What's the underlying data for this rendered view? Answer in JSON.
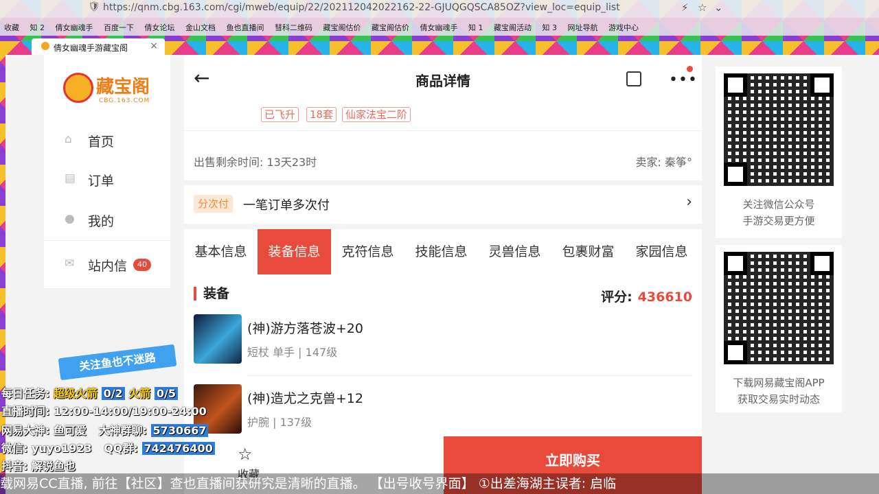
{
  "browser": {
    "url": "https://qnm.cbg.163.com/cgi/mweb/equip/22/202112042022162-22-GJUQGQSCA85OZ?view_loc=equip_list",
    "bookmarks": [
      "收藏",
      "知 2",
      "倩女幽魂手",
      "百度一下",
      "倩女论坛",
      "金山文档",
      "鱼也直播间",
      "彗科二维码",
      "藏宝阁估价",
      "藏宝阁估价",
      "倩女幽魂手",
      "知 1",
      "藏宝阁活动",
      "知 3",
      "网址导航",
      "游戏中心"
    ],
    "tab_title": "倩女幽魂手游藏宝阁"
  },
  "sidebar": {
    "logo_name": "藏宝阁",
    "logo_sub": "CBG.163.COM",
    "items": [
      {
        "label": "首页",
        "icon": "home-icon"
      },
      {
        "label": "订单",
        "icon": "order-icon"
      },
      {
        "label": "我的",
        "icon": "user-icon"
      }
    ],
    "messages": {
      "label": "站内信",
      "count": "40"
    }
  },
  "header": {
    "title": "商品详情"
  },
  "tags": [
    "已飞升",
    "18套",
    "仙家法宝二阶"
  ],
  "sale": {
    "time_left": "出售剩余时间: 13天23时",
    "seller": "卖家: 秦筝°"
  },
  "pay": {
    "tag": "分次付",
    "text": "一笔订单多次付"
  },
  "tabs": [
    "基本信息",
    "装备信息",
    "克符信息",
    "技能信息",
    "灵兽信息",
    "包裹财富",
    "家园信息"
  ],
  "equip": {
    "section": "装备",
    "score_label": "评分:",
    "score_value": "436610",
    "items": [
      {
        "name": "(神)游方落苍波+20",
        "desc": "短杖 单手 | 147级"
      },
      {
        "name": "(神)造尤之克兽+12",
        "desc": "护腕 | 137级"
      }
    ]
  },
  "bottom": {
    "fav_label": "收藏",
    "buy_label": "立即购买"
  },
  "right": {
    "qr1": [
      "关注微信公众号",
      "手游交易更方便"
    ],
    "qr2": [
      "下载网易藏宝阁APP",
      "获取交易实时动态"
    ]
  },
  "overlay": {
    "banner": "关注鱼也不迷路",
    "task_label": "每日任务:",
    "task1_name": "超级火箭",
    "task1_val": "0/2",
    "task2_name": "火箭",
    "task2_val": "0/5",
    "live_time": "直播时间: 12:00-14:00/19:00-24:00",
    "netease": "网易大神: 鱼可爱",
    "group_label": "大神群聊:",
    "group_val": "5730667",
    "wechat": "微信: yuyo1923",
    "qq_label": "QQ群:",
    "qq_val": "742476400",
    "douyin": "抖音: 解说鱼也",
    "ticker": "载网易CC直播, 前往【社区】查也直播间获研究是清晰的直播。   【出号收号界面】 ①出差海湖主误者: 启临"
  }
}
